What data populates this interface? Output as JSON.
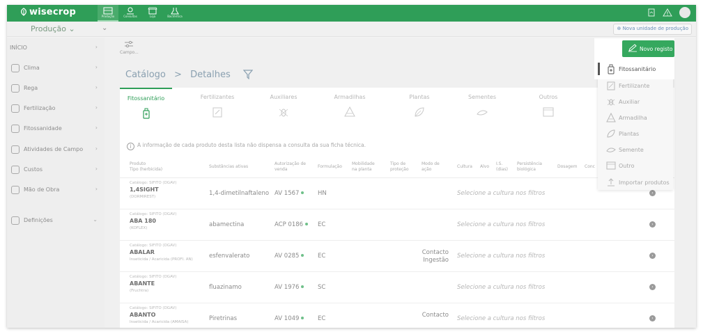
{
  "app": {
    "logo": "wisecrop",
    "nav_tabs": [
      "Produção",
      "Consultas",
      "Loja",
      "Bactéritica"
    ],
    "production_select": "Produção",
    "nova_unidade": "Nova unidade de produção"
  },
  "sidebar": {
    "header": "INÍCIO",
    "items": [
      {
        "label": "Clima",
        "icon": "cloud-icon"
      },
      {
        "label": "Rega",
        "icon": "water-icon"
      },
      {
        "label": "Fertilização",
        "icon": "fertilizer-icon"
      },
      {
        "label": "Fitossanidade",
        "icon": "pest-icon"
      },
      {
        "label": "Atividades de Campo",
        "icon": "activity-icon"
      },
      {
        "label": "Custos",
        "icon": "coin-icon"
      },
      {
        "label": "Mão de Obra",
        "icon": "worker-icon"
      },
      {
        "label": "Definições",
        "icon": "settings-icon"
      }
    ]
  },
  "main": {
    "campo_label": "Campo...",
    "breadcrumb": {
      "root": "Catálogo",
      "sep": ">",
      "current": "Detalhes"
    },
    "tabs": [
      "Fitossanitário",
      "Fertilizantes",
      "Auxiliares",
      "Armadilhas",
      "Plantas",
      "Sementes",
      "Outros"
    ],
    "info_text": "A informação de cada produto desta lista não dispensa a consulta da sua ficha técnica.",
    "headers": {
      "produto": "Produto",
      "tipo": "Tipo (herbicida)",
      "substancias": "Substâncias ativas",
      "autorizacao": "Autorização de venda",
      "formulacao": "Formulação",
      "mobilidade": "Mobilidade na planta",
      "tipo_protecao": "Tipo de proteção",
      "modo_acao": "Modo de ação",
      "cultura": "Cultura",
      "alvo": "Alvo",
      "is": "I.S. (dias)",
      "persistencia": "Persistência biológica",
      "dosagem": "Dosagem",
      "conc": "Conc"
    },
    "rows": [
      {
        "catalog": "Catálogo: SIFITO (DGAV)",
        "name": "1,4SIGHT",
        "sub": "(DORMIREST)",
        "substance": "1,4-dimetilnaftaleno",
        "auth": "AV 1567",
        "form": "HN",
        "modo": "",
        "cultura": "Selecione a cultura nos filtros"
      },
      {
        "catalog": "Catálogo: SIFITO (DGAV)",
        "name": "ABA 180",
        "sub": "(KOFLEX)",
        "substance": "abamectina",
        "auth": "ACP 0186",
        "form": "EC",
        "modo": "",
        "cultura": "Selecione a cultura nos filtros"
      },
      {
        "catalog": "Catálogo: SIFITO (DGAV)",
        "name": "ABALAR",
        "sub": "Inseticida / Acaricida (PROFI. AN)",
        "substance": "esfenvalerato",
        "auth": "AV 0285",
        "form": "EC",
        "modo": "Contacto Ingestão",
        "cultura": "Selecione a cultura nos filtros"
      },
      {
        "catalog": "Catálogo: SIFITO (DGAV)",
        "name": "ABANTE",
        "sub": "(Fruchtra)",
        "substance": "fluazinamo",
        "auth": "AV 1976",
        "form": "SC",
        "modo": "",
        "cultura": "Selecione a cultura nos filtros"
      },
      {
        "catalog": "Catálogo: SIFITO (DGAV)",
        "name": "ABANTO",
        "sub": "Inseticida / Acaricida (AMAISA)",
        "substance": "Piretrinas",
        "auth": "AV 1049",
        "form": "EC",
        "modo": "Contacto",
        "cultura": "Selecione a cultura nos filtros"
      }
    ]
  },
  "dropdown": {
    "novo_registo": "Novo registo",
    "items": [
      "Fitossanitário",
      "Fertilizante",
      "Auxiliar",
      "Armadilha",
      "Plantas",
      "Semente",
      "Outro",
      "Importar produtos"
    ]
  },
  "colors": {
    "brand": "#2f9e58",
    "button": "#35a85e"
  }
}
